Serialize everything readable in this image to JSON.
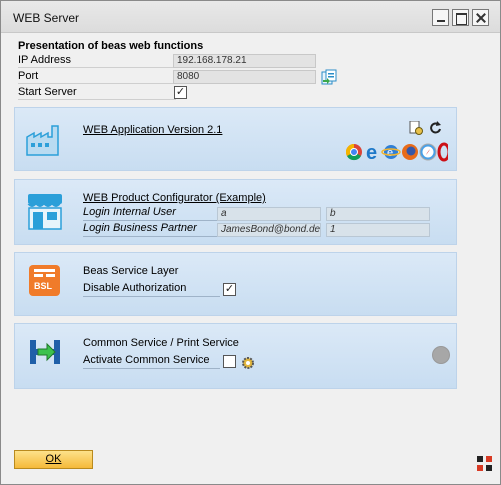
{
  "window": {
    "title": "WEB Server"
  },
  "main": {
    "heading": "Presentation of beas web functions",
    "ip_label": "IP Address",
    "ip_value": "192.168.178.21",
    "port_label": "Port",
    "port_value": "8080",
    "start_label": "Start Server",
    "start_checked": true
  },
  "web_app": {
    "title": "WEB Application Version 2.1"
  },
  "configurator": {
    "title": "WEB Product Configurator (Example)",
    "internal_label": "Login Internal User",
    "internal_user": "a",
    "internal_password": "b",
    "partner_label": "Login Business Partner",
    "partner_user": "JamesBond@bond.de",
    "partner_password": "1"
  },
  "service_layer": {
    "title": "Beas Service Layer",
    "icon_text": "BSL",
    "disable_label": "Disable Authorization",
    "disable_checked": true
  },
  "common_service": {
    "title": "Common Service / Print Service",
    "activate_label": "Activate Common Service",
    "activate_checked": false
  },
  "footer": {
    "ok_label": "OK"
  },
  "colors": {
    "panel": "#d3e4f5",
    "ok_button": "#f5b93a",
    "accent_icon": "#2b9fd9"
  }
}
